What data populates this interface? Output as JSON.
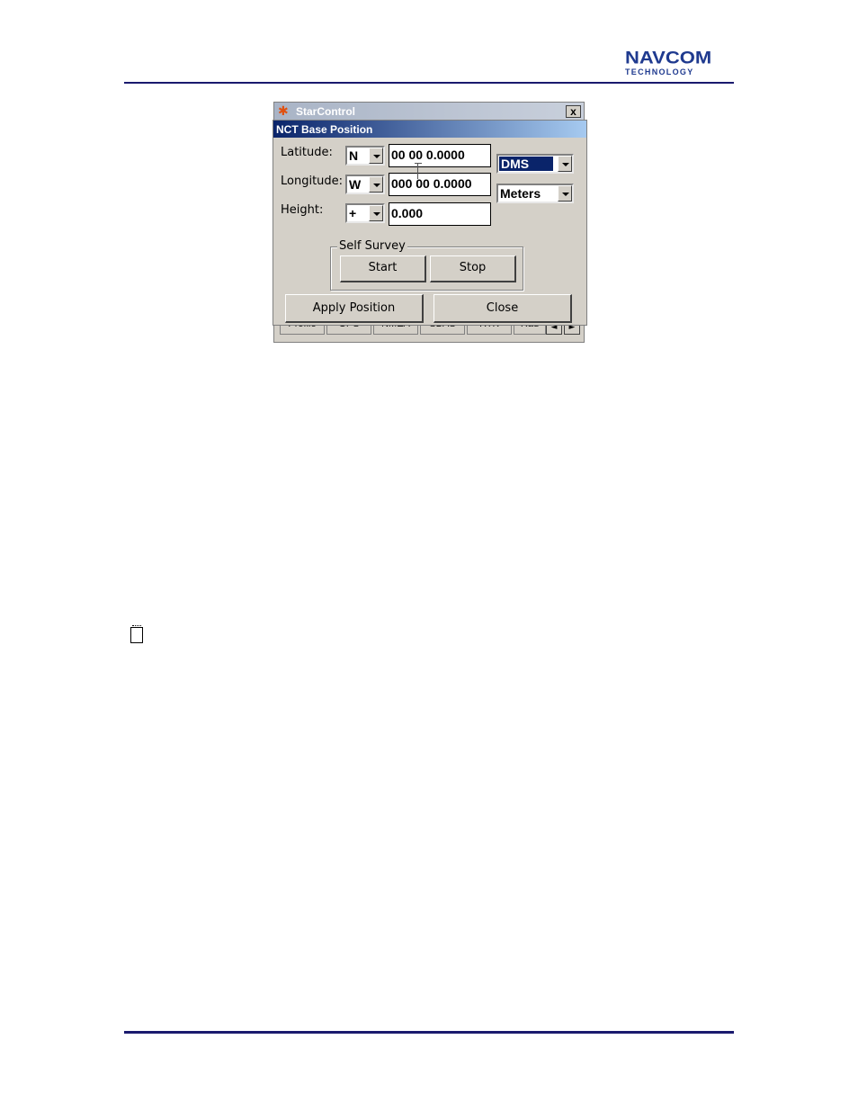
{
  "header": {
    "logo_main": "NAVCOM",
    "logo_sub": "TECHNOLOGY",
    "brand_color": "#1f3a8f"
  },
  "app_window": {
    "title": "StarControl",
    "close_label": "x",
    "tabs": [
      "Profile",
      "GPS",
      "NMEA",
      "SBAS",
      "RTK",
      "Rad"
    ],
    "tab_left_arrow": "◄",
    "tab_right_arrow": "►"
  },
  "dialog": {
    "title": "NCT Base Position",
    "latitude": {
      "label": "Latitude:",
      "hemisphere": "N",
      "value": "00 00 0.0000"
    },
    "longitude": {
      "label": "Longitude:",
      "hemisphere": "W",
      "value": "000 00 0.0000"
    },
    "height": {
      "label": "Height:",
      "sign": "+",
      "value": "0.000"
    },
    "format_select": "DMS",
    "unit_select": "Meters",
    "self_survey": {
      "label": "Self Survey",
      "start_label": "Start",
      "stop_label": "Stop"
    },
    "apply_label": "Apply Position",
    "close_label": "Close"
  }
}
